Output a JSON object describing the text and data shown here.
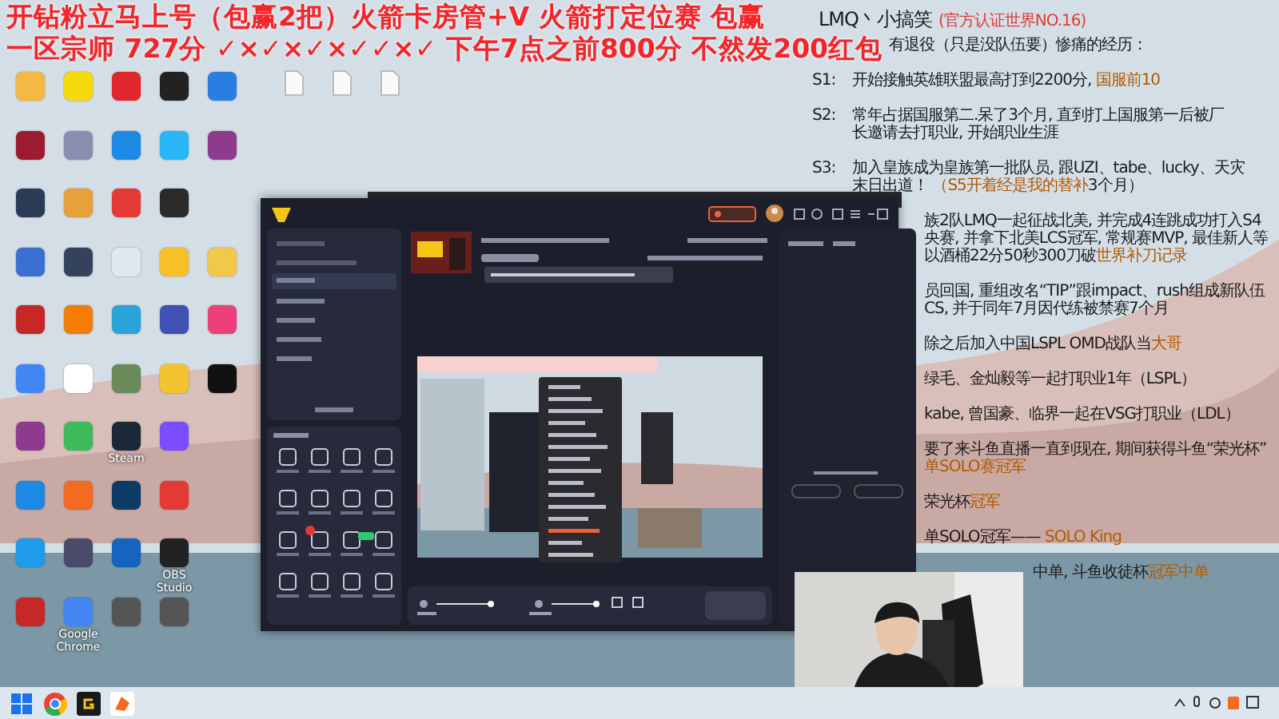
{
  "banner": {
    "lines": [
      "开钻粉立马上号（包赢2把）火箭卡房管+V  火箭打定位赛 包赢",
      "一区宗师 727分 ✓×✓×✓×✓✓×✓ 下午7点之前800分 不然发200红包"
    ]
  },
  "desktop_files": [
    {
      "kind": "document"
    },
    {
      "kind": "document"
    },
    {
      "kind": "document"
    }
  ],
  "desktop_icons": [
    [
      {
        "color": "#f4b942"
      },
      {
        "color": "#f5d90a"
      },
      {
        "color": "#e0262c"
      },
      {
        "color": "#222222"
      },
      {
        "color": "#2a7de1"
      }
    ],
    [
      {
        "color": "#9b1b30"
      },
      {
        "color": "#8a8fb0"
      },
      {
        "color": "#1e88e5"
      },
      {
        "color": "#29b6f6"
      },
      {
        "color": "#8e3b8e"
      }
    ],
    [
      {
        "color": "#2b3a55"
      },
      {
        "color": "#e8a13a"
      },
      {
        "color": "#e53935"
      },
      {
        "color": "#2a2a2a"
      }
    ],
    [
      {
        "color": "#3b6fd1"
      },
      {
        "color": "#34425e"
      },
      {
        "color": "#dfe8ee"
      },
      {
        "color": "#f6c028"
      },
      {
        "color": "#f2c84b"
      }
    ],
    [
      {
        "color": "#c62828"
      },
      {
        "color": "#f57c00"
      },
      {
        "color": "#29a3d9"
      },
      {
        "color": "#3f51b5"
      },
      {
        "color": "#ec407a"
      }
    ],
    [
      {
        "color": "#4285f4"
      },
      {
        "color": "#ffffff"
      },
      {
        "color": "#6a8a5a"
      },
      {
        "color": "#f4c430"
      },
      {
        "color": "#111111"
      }
    ],
    [
      {
        "color": "#8e3b8e"
      },
      {
        "color": "#3dbb5a"
      },
      {
        "color": "#1b2838",
        "label": "Steam"
      },
      {
        "color": "#7c4dff"
      }
    ],
    [
      {
        "color": "#1e88e5"
      },
      {
        "color": "#f26b21"
      },
      {
        "color": "#0d3b66"
      },
      {
        "color": "#e53935"
      }
    ],
    [
      {
        "color": "#1e9be9"
      },
      {
        "color": "#4a4a6a"
      },
      {
        "color": "#1565c0"
      },
      {
        "color": "#222222",
        "label": "OBS Studio"
      }
    ],
    [
      {
        "color": "#c62828"
      },
      {
        "color": "#4285f4",
        "label": "Google Chrome"
      },
      {
        "color": "#555555"
      },
      {
        "color": "#555555"
      }
    ]
  ],
  "notes": {
    "title": "LMQ丶小搞笑",
    "badge": "(官方认证世界NO.16)",
    "paragraphs": [
      {
        "kind": "after-banner",
        "lines": [
          [
            {
              "text": "有退役（只是没队伍要）惨痛的经历：",
              "highlight": false
            }
          ]
        ]
      },
      {
        "kind": "labelled",
        "label": "S1:",
        "lines": [
          [
            {
              "text": "开始接触英雄联盟最高打到2200分, ",
              "highlight": false
            },
            {
              "text": "国服前10",
              "highlight": true
            }
          ]
        ]
      },
      {
        "kind": "labelled",
        "label": "S2:",
        "lines": [
          [
            {
              "text": "常年占据国服第二.呆了3个月, 直到打上国服第一后被厂",
              "highlight": false
            }
          ],
          [
            {
              "text": "长邀请去打职业, 开始职业生涯",
              "highlight": false
            }
          ]
        ]
      },
      {
        "kind": "labelled",
        "label": "S3:",
        "lines": [
          [
            {
              "text": "加入皇族成为皇族第一批队员, 跟UZI、tabe、lucky、天灾",
              "highlight": false
            }
          ],
          [
            {
              "text": "末日出道！  ",
              "highlight": false
            },
            {
              "text": "（S5开着经是我的替补",
              "highlight": true
            },
            {
              "text": "3个月）",
              "highlight": false
            }
          ]
        ]
      },
      {
        "kind": "after-window",
        "lines": [
          [
            {
              "text": "族2队LMQ一起征战北美, 并完成4连跳成功打入S4",
              "highlight": false
            }
          ],
          [
            {
              "text": "央赛, 并拿下北美LCS冠军, 常规赛MVP, 最佳新人等",
              "highlight": false
            }
          ],
          [
            {
              "text": "以酒桶22分50秒300刀破",
              "highlight": false
            },
            {
              "text": "世界补刀记录",
              "highlight": true
            }
          ]
        ]
      },
      {
        "kind": "after-window",
        "lines": [
          [
            {
              "text": "员回国, 重组改名“TIP”跟impact、rush组成新队伍",
              "highlight": false
            }
          ],
          [
            {
              "text": "CS, 并于同年7月因代练被禁赛7个月",
              "highlight": false
            }
          ]
        ]
      },
      {
        "kind": "after-window",
        "lines": [
          [
            {
              "text": "除之后加入中国LSPL OMD战队当",
              "highlight": false
            },
            {
              "text": "大哥",
              "highlight": true
            }
          ]
        ]
      },
      {
        "kind": "after-window",
        "lines": [
          [
            {
              "text": "绿毛、金灿毅等一起打职业1年（LSPL）",
              "highlight": false
            }
          ]
        ]
      },
      {
        "kind": "after-window",
        "lines": [
          [
            {
              "text": "kabe, 曾国豪、临界一起在VSG打职业（LDL）",
              "highlight": false
            }
          ]
        ]
      },
      {
        "kind": "after-window",
        "lines": [
          [
            {
              "text": "要了来斗鱼直播一直到现在, 期间获得斗鱼“荣光杯”",
              "highlight": false
            }
          ],
          [
            {
              "text": "单SOLO赛冠军",
              "highlight": true
            }
          ]
        ]
      },
      {
        "kind": "after-window",
        "lines": [
          [
            {
              "text": "荣光杯",
              "highlight": false
            },
            {
              "text": "冠军",
              "highlight": true
            }
          ]
        ]
      },
      {
        "kind": "after-window",
        "lines": [
          [
            {
              "text": "单SOLO冠军——  ",
              "highlight": false
            },
            {
              "text": "SOLO King",
              "highlight": true
            }
          ]
        ]
      },
      {
        "kind": "after-webcam",
        "lines": [
          [
            {
              "text": "中单, 斗鱼收徒杯",
              "highlight": false
            },
            {
              "text": "冠军中单",
              "highlight": true
            }
          ]
        ]
      }
    ]
  },
  "taskbar": {
    "apps": [
      {
        "kind": "start"
      },
      {
        "kind": "browser"
      },
      {
        "kind": "game"
      },
      {
        "kind": "stream"
      }
    ]
  }
}
